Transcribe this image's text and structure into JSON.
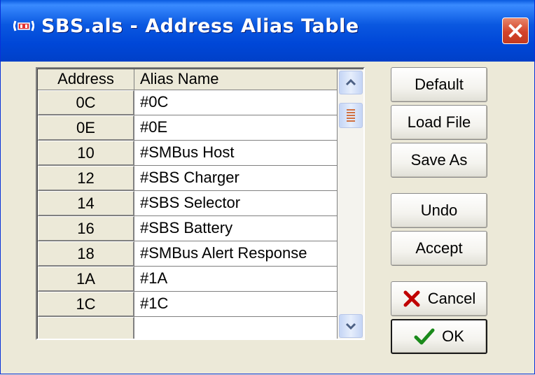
{
  "window": {
    "title": "SBS.als - Address Alias Table",
    "icon": "app-icon",
    "close_icon": "close-icon"
  },
  "table": {
    "columns": [
      "Address",
      "Alias Name"
    ],
    "rows": [
      {
        "address": "0C",
        "alias": "#0C"
      },
      {
        "address": "0E",
        "alias": "#0E"
      },
      {
        "address": "10",
        "alias": "#SMBus Host"
      },
      {
        "address": "12",
        "alias": "#SBS Charger"
      },
      {
        "address": "14",
        "alias": "#SBS Selector"
      },
      {
        "address": "16",
        "alias": "#SBS Battery"
      },
      {
        "address": "18",
        "alias": "#SMBus Alert Response"
      },
      {
        "address": "1A",
        "alias": "#1A"
      },
      {
        "address": "1C",
        "alias": "#1C"
      },
      {
        "address": "",
        "alias": ""
      }
    ]
  },
  "buttons": {
    "default": "Default",
    "load_file": "Load File",
    "save_as": "Save As",
    "undo": "Undo",
    "accept": "Accept",
    "cancel": "Cancel",
    "ok": "OK"
  },
  "colors": {
    "title_bar": "#0a58e0",
    "cancel_icon": "#c00000",
    "ok_icon": "#1a8a1a"
  }
}
